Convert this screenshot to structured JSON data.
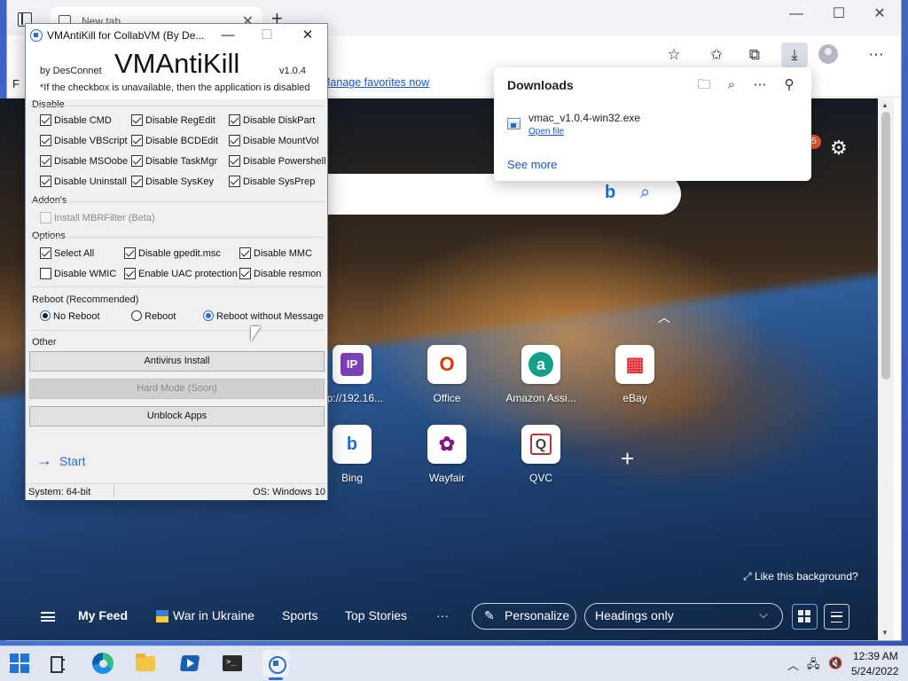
{
  "browser": {
    "tab_title": "New tab",
    "tab_close": "✕",
    "new_tab_plus": "+",
    "window_controls": {
      "minimize": "—",
      "maximize": "☐",
      "close": "✕"
    },
    "toolbar_icons": [
      "add-favorite-icon",
      "favorites-icon",
      "collections-icon",
      "downloads-icon",
      "profile-icon",
      "more-options-icon"
    ],
    "favorites_bar_letter": "F",
    "manage_favorites": "Manage favorites now"
  },
  "downloads": {
    "title": "Downloads",
    "actions": [
      "open-folder-icon",
      "search-icon",
      "more-icon",
      "pin-icon"
    ],
    "item": {
      "filename": "vmac_v1.0.4-win32.exe",
      "action": "Open file"
    },
    "see_more": "See more"
  },
  "ntp": {
    "notification_count": "5",
    "tiles": [
      {
        "label": "ttp://192.16...",
        "glyph": "IP",
        "color": "#7b3fb6"
      },
      {
        "label": "Office",
        "glyph": "O",
        "color": "#d83b01"
      },
      {
        "label": "Amazon Assi...",
        "glyph": "a",
        "color": "#12a08a"
      },
      {
        "label": "eBay",
        "glyph": "▦",
        "color": "#e53238"
      },
      {
        "label": "Bing",
        "glyph": "b",
        "color": "#1b6fd6"
      },
      {
        "label": "Wayfair",
        "glyph": "✿",
        "color": "#7f187f"
      },
      {
        "label": "QVC",
        "glyph": "Q",
        "color": "#444444"
      }
    ],
    "add_tile": "+",
    "like_background": "Like this background?",
    "feed": {
      "my_feed": "My Feed",
      "war_in_ukraine": "War in Ukraine",
      "sports": "Sports",
      "top_stories": "Top Stories",
      "more": "···",
      "personalize": "Personalize",
      "headings": "Headings only"
    }
  },
  "vmak": {
    "title": "VMAntiKill for CollabVM (By De...",
    "window_controls": {
      "minimize": "—",
      "maximize": "☐",
      "close": "✕"
    },
    "by": "by DesConnet",
    "logo": "VMAntiKill",
    "version": "v1.0.4",
    "note": "*If the checkbox is unavailable, then the application is disabled",
    "disable": {
      "label": "Disable",
      "items": [
        {
          "label": "Disable CMD",
          "checked": true
        },
        {
          "label": "Disable RegEdit",
          "checked": true
        },
        {
          "label": "Disable DiskPart",
          "checked": true
        },
        {
          "label": "Disable VBScript",
          "checked": true
        },
        {
          "label": "Disable BCDEdit",
          "checked": true
        },
        {
          "label": "Disable MountVol",
          "checked": true
        },
        {
          "label": "Disable MSOobe",
          "checked": true
        },
        {
          "label": "Disable TaskMgr",
          "checked": true
        },
        {
          "label": "Disable Powershell",
          "checked": true
        },
        {
          "label": "Disable Uninstall",
          "checked": true
        },
        {
          "label": "Disable SysKey",
          "checked": true
        },
        {
          "label": "Disable SysPrep",
          "checked": true
        }
      ]
    },
    "addons": {
      "label": "Addon's",
      "item": {
        "label": "Install MBRFilter (Beta)",
        "checked": false,
        "disabled": true
      }
    },
    "options": {
      "label": "Options",
      "items": [
        {
          "label": "Select All",
          "checked": true
        },
        {
          "label": "Disable gpedit.msc",
          "checked": true
        },
        {
          "label": "Disable MMC",
          "checked": true
        },
        {
          "label": "Disable WMIC",
          "checked": false
        },
        {
          "label": "Enable UAC protection",
          "checked": true
        },
        {
          "label": "Disable resmon",
          "checked": true
        }
      ]
    },
    "reboot": {
      "label": "Reboot (Recommended)",
      "options": [
        {
          "label": "No Reboot",
          "selected": true
        },
        {
          "label": "Reboot",
          "selected": false
        },
        {
          "label": "Reboot without Message",
          "selected": true
        }
      ]
    },
    "other": {
      "label": "Other",
      "buttons": [
        {
          "label": "Antivirus Install",
          "disabled": false
        },
        {
          "label": "Hard Mode (Soon)",
          "disabled": true
        },
        {
          "label": "Unblock Apps",
          "disabled": false
        }
      ]
    },
    "start": "Start",
    "start_arrow": "→",
    "status": {
      "system": "System: 64-bit",
      "os": "OS: Windows 10"
    }
  },
  "taskbar": {
    "apps": [
      "start-logo",
      "task-view",
      "edge",
      "file-explorer",
      "media-player",
      "terminal",
      "vmantikill"
    ],
    "tray": {
      "chevron": "︿",
      "network": "🖧",
      "volume": "🔇"
    },
    "clock_time": "12:39 AM",
    "clock_date": "5/24/2022"
  }
}
